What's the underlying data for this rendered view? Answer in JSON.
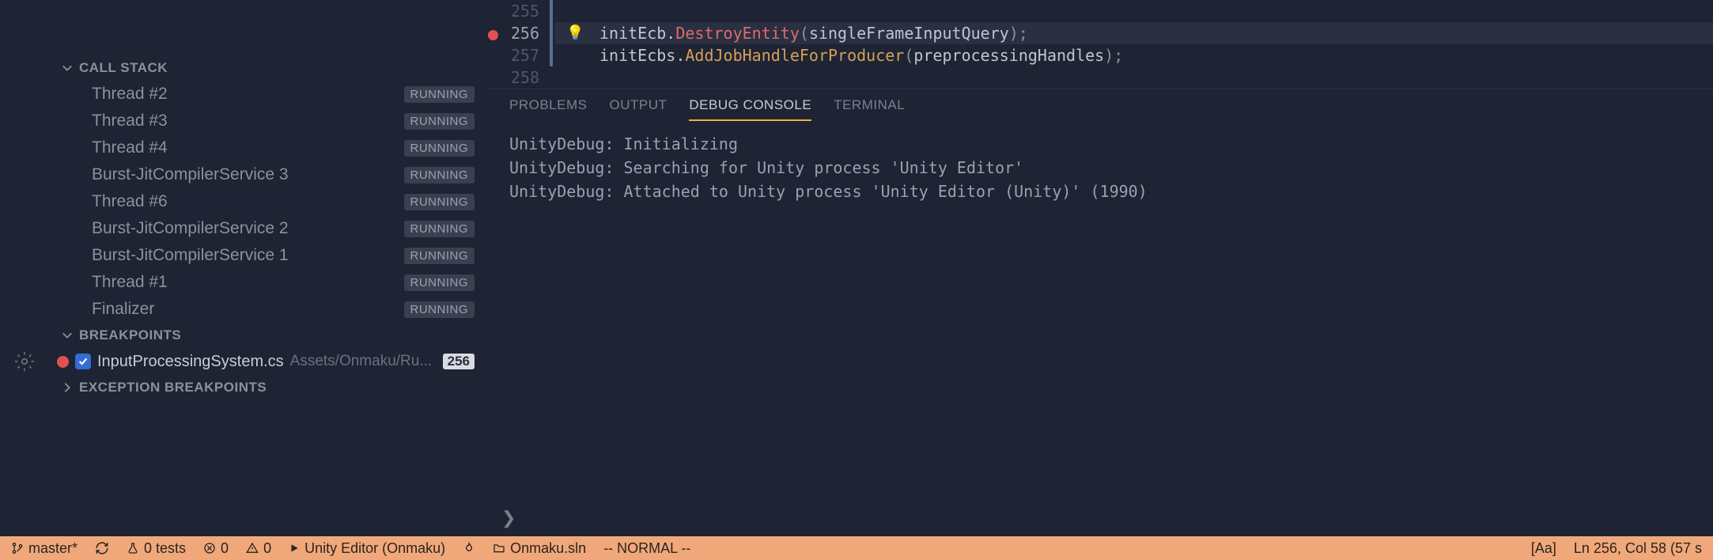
{
  "sidebar": {
    "callstack_label": "CALL STACK",
    "threads": [
      {
        "name": "Thread #2",
        "status": "RUNNING"
      },
      {
        "name": "Thread #3",
        "status": "RUNNING"
      },
      {
        "name": "Thread #4",
        "status": "RUNNING"
      },
      {
        "name": "Burst-JitCompilerService 3",
        "status": "RUNNING"
      },
      {
        "name": "Thread #6",
        "status": "RUNNING"
      },
      {
        "name": "Burst-JitCompilerService 2",
        "status": "RUNNING"
      },
      {
        "name": "Burst-JitCompilerService 1",
        "status": "RUNNING"
      },
      {
        "name": "Thread #1",
        "status": "RUNNING"
      },
      {
        "name": "Finalizer",
        "status": "RUNNING"
      }
    ],
    "breakpoints_label": "BREAKPOINTS",
    "breakpoint": {
      "file": "InputProcessingSystem.cs",
      "path": "Assets/Onmaku/Ru...",
      "line": "256"
    },
    "exception_bp_label": "EXCEPTION BREAKPOINTS"
  },
  "editor": {
    "lines": [
      "255",
      "256",
      "257",
      "258"
    ],
    "l256": {
      "obj": "initEcb",
      "dot": ".",
      "fn": "DestroyEntity",
      "op": "(",
      "arg": "singleFrameInputQuery",
      "cp": ");"
    },
    "l257": {
      "obj": "initEcbs",
      "dot": ".",
      "fn": "AddJobHandleForProducer",
      "op": "(",
      "arg": "preprocessingHandles",
      "cp": ");"
    }
  },
  "panel": {
    "tabs": {
      "problems": "PROBLEMS",
      "output": "OUTPUT",
      "debug": "DEBUG CONSOLE",
      "terminal": "TERMINAL"
    },
    "lines": [
      "UnityDebug: Initializing",
      "UnityDebug: Searching for Unity process 'Unity Editor'",
      "UnityDebug: Attached to Unity process 'Unity Editor (Unity)' (1990)"
    ],
    "prompt": "❯"
  },
  "statusbar": {
    "branch": "master*",
    "tests": "0 tests",
    "errors": "0",
    "warnings": "0",
    "launch": "Unity Editor (Onmaku)",
    "solution": "Onmaku.sln",
    "mode": "-- NORMAL --",
    "case": "[Aa]",
    "position": "Ln 256, Col 58 (57 s"
  }
}
